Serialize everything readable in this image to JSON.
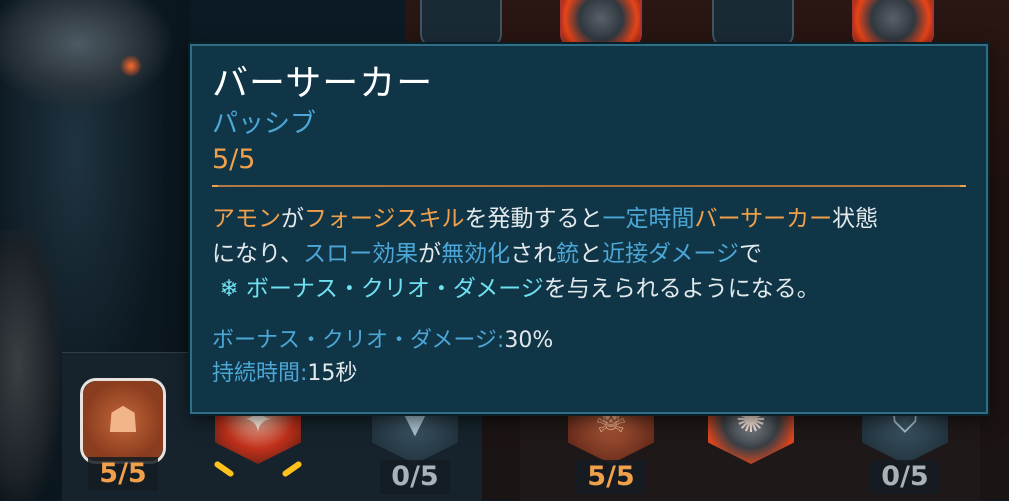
{
  "tooltip": {
    "title": "バーサーカー",
    "type": "パッシブ",
    "level": "5/5",
    "description": {
      "l1_a": "アモン",
      "l1_b": "が",
      "l1_c": "フォージスキル",
      "l1_d": "を発動すると",
      "l1_e": "一定時間",
      "l1_f": "バーサーカー",
      "l1_g": "状態",
      "l2_a": "になり、",
      "l2_b": "スロー",
      "l2_c": "効果",
      "l2_d": "が",
      "l2_e": "無効化",
      "l2_f": "され",
      "l2_g": "銃",
      "l2_h": "と",
      "l2_i": "近接ダメージ",
      "l2_j": "で",
      "l3_icon": "❄",
      "l3_a": "ボーナス・クリオ・ダメージ",
      "l3_b": "を与えられるようになる。"
    },
    "stats": [
      {
        "label": "ボーナス・クリオ・ダメージ:",
        "value": "30%"
      },
      {
        "label": "持続時間:",
        "value": "15秒"
      }
    ]
  },
  "skill_nodes": [
    {
      "count": "5/5",
      "icon": "demon-face-icon"
    },
    {
      "count": "",
      "icon": "fire-claw-icon"
    },
    {
      "count": "0/5",
      "icon": "fang-mouth-icon"
    },
    {
      "count": "5/5",
      "icon": "skull-icon"
    },
    {
      "count": "",
      "icon": "flaming-beast-icon"
    },
    {
      "count": "0/5",
      "icon": "shield-rank-icon"
    }
  ],
  "colors": {
    "accent_orange": "#f0a04b",
    "accent_blue": "#4ca6d6",
    "accent_cyan": "#6fe0ef",
    "tooltip_bg": "#0f3546"
  }
}
